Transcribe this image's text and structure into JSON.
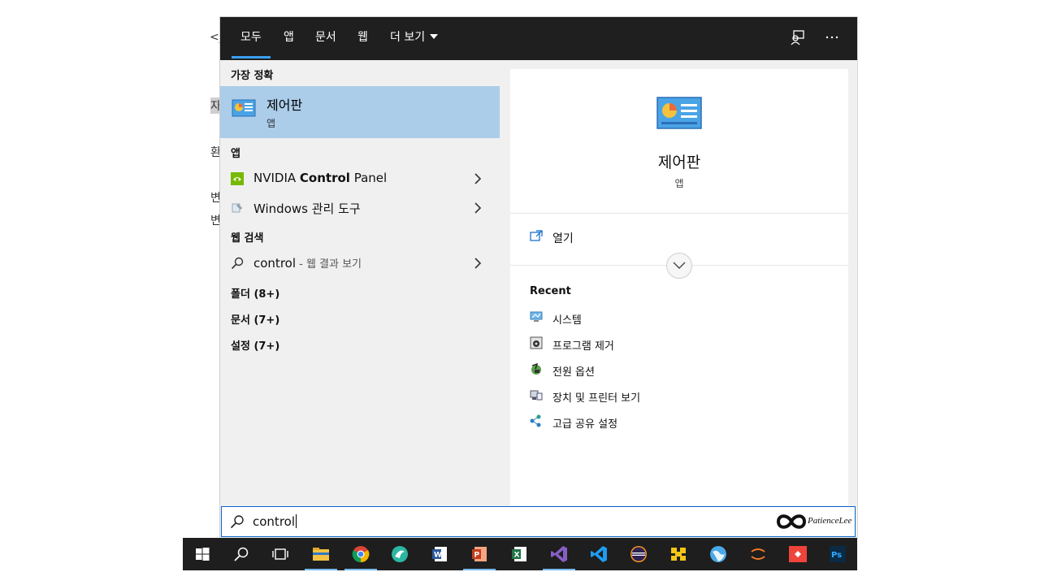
{
  "background": {
    "fragments": [
      "<j",
      "자",
      "환",
      "변",
      "변"
    ]
  },
  "tabs": [
    {
      "label": "모두",
      "active": true
    },
    {
      "label": "앱"
    },
    {
      "label": "문서"
    },
    {
      "label": "웹"
    },
    {
      "label": "더 보기"
    }
  ],
  "sections": {
    "best_match": "가장 정확",
    "apps": "앱",
    "web": "웹 검색",
    "folders": "폴더 (8+)",
    "documents": "문서 (7+)",
    "settings": "설정 (7+)"
  },
  "best_match": {
    "title": "제어판",
    "subtitle": "앱"
  },
  "apps": [
    {
      "prefix": "NVIDIA ",
      "bold": "Control",
      "suffix": " Panel",
      "icon": "nvidia-icon"
    },
    {
      "prefix": "Windows 관리 도구",
      "bold": "",
      "suffix": "",
      "icon": "admin-tools-icon"
    }
  ],
  "web_result": {
    "query": "control",
    "suffix": " - 웹 결과 보기",
    "icon": "search-icon"
  },
  "detail": {
    "title": "제어판",
    "subtitle": "앱",
    "open_label": "열기",
    "recent_header": "Recent",
    "recent": [
      {
        "label": "시스템",
        "icon": "system-icon"
      },
      {
        "label": "프로그램 제거",
        "icon": "uninstall-icon"
      },
      {
        "label": "전원 옵션",
        "icon": "power-icon"
      },
      {
        "label": "장치 및 프린터 보기",
        "icon": "devices-icon"
      },
      {
        "label": "고급 공유 설정",
        "icon": "network-icon"
      }
    ]
  },
  "search": {
    "value": "control"
  },
  "colors": {
    "accent": "#0a66c9",
    "selection": "#abcdea",
    "topbar": "#1f1f1f",
    "tab_underline": "#3aa0f3"
  }
}
